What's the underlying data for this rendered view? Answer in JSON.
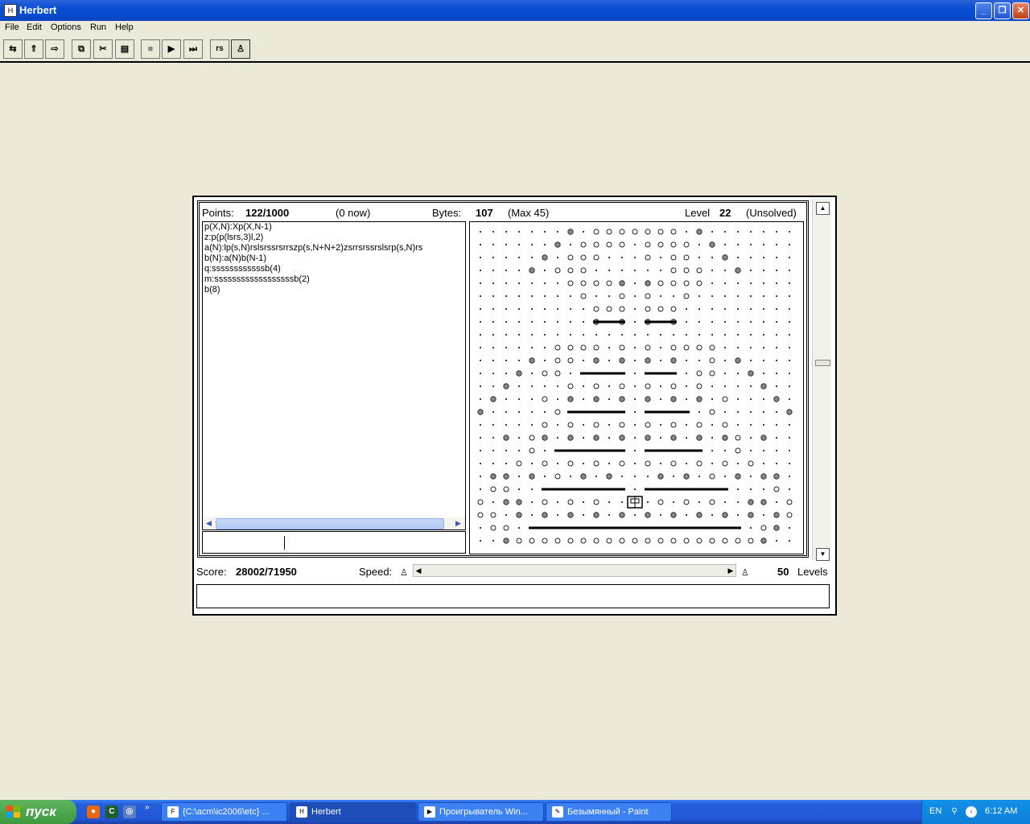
{
  "window": {
    "title": "Herbert",
    "controls": {
      "minimize": "_",
      "maximize": "❐",
      "close": "✕"
    }
  },
  "menu": [
    "File",
    "Edit",
    "Options",
    "Run",
    "Help"
  ],
  "toolbar": [
    {
      "name": "load-icon",
      "glyph": "⇆"
    },
    {
      "name": "upload-icon",
      "glyph": "⇑"
    },
    {
      "name": "next-level-icon",
      "glyph": "⇨"
    },
    {
      "name": "copy-icon",
      "glyph": "⧉"
    },
    {
      "name": "cut-icon",
      "glyph": "✂"
    },
    {
      "name": "paste-icon",
      "glyph": "▤"
    },
    {
      "name": "stop-icon",
      "glyph": "■"
    },
    {
      "name": "play-icon",
      "glyph": "▶"
    },
    {
      "name": "step-icon",
      "glyph": "⏭"
    },
    {
      "name": "rsl-icon",
      "glyph": "rs"
    },
    {
      "name": "robot-icon",
      "glyph": "♙"
    }
  ],
  "stats": {
    "points_label": "Points:",
    "points_value": "122/1000",
    "now": "(0 now)",
    "bytes_label": "Bytes:",
    "bytes_value": "107",
    "max": "(Max 45)",
    "level_label": "Level",
    "level_value": "22",
    "status": "(Unsolved)"
  },
  "code_lines": [
    "p(X,N):Xp(X,N-1)",
    "z:p(p(lsrs,3)l,2)",
    "a(N):lp(s,N)rslsrssrsrrszp(s,N+N+2)zsrrsrssrslsrp(s,N)rs",
    "b(N):a(N)b(N-1)",
    "q:ssssssssssssb(4)",
    "m:ssssssssssssssssssb(2)",
    "b(8)"
  ],
  "bottom": {
    "score_label": "Score:",
    "score_value": "28002/71950",
    "speed_label": "Speed:",
    "levels_value": "50",
    "levels_label": "Levels"
  },
  "taskbar": {
    "start_label": "пуск",
    "tasks": [
      {
        "label": "{C:\\acm\\ic2006\\etc} ...",
        "icon": "F"
      },
      {
        "label": "Herbert",
        "icon": "H"
      },
      {
        "label": "Проигрыватель Win...",
        "icon": "▶"
      },
      {
        "label": "Безымянный - Paint",
        "icon": "✎"
      }
    ],
    "lang": "EN",
    "clock": "6:12 AM"
  },
  "colors": {
    "desktop": "#ECE9D8",
    "titlebar": "#0A4FD6",
    "taskbar": "#245EDB",
    "start": "#3C9A3C",
    "grey_dot": "#888888"
  }
}
